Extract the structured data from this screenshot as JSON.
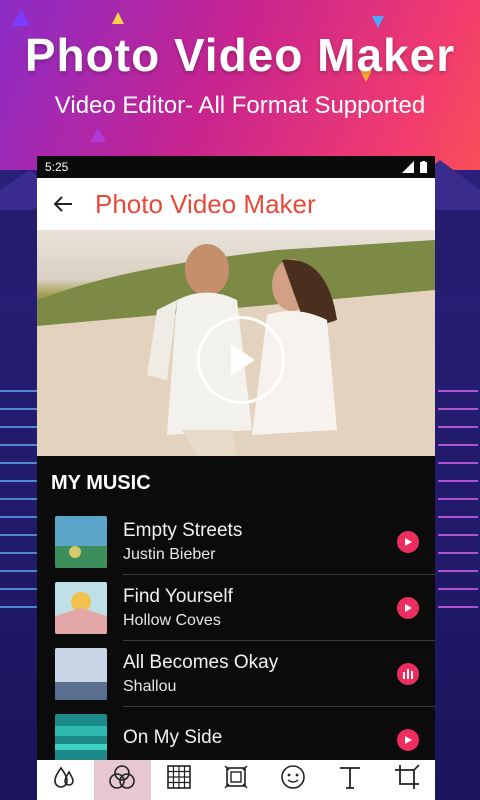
{
  "promo": {
    "title": "Photo Video Maker",
    "subtitle": "Video Editor- All Format Supported"
  },
  "status_bar": {
    "time": "5:25"
  },
  "app_bar": {
    "title": "Photo Video Maker",
    "back_icon": "arrow-left-icon"
  },
  "video": {
    "play_icon": "play-icon"
  },
  "music": {
    "header": "MY MUSIC",
    "tracks": [
      {
        "title": "Empty Streets",
        "artist": "Justin Bieber",
        "state": "play"
      },
      {
        "title": "Find Yourself",
        "artist": "Hollow  Coves",
        "state": "play"
      },
      {
        "title": "All Becomes Okay",
        "artist": "Shallou",
        "state": "playing"
      },
      {
        "title": "On My Side",
        "artist": "",
        "state": "play"
      }
    ]
  },
  "toolbar": {
    "tools": [
      {
        "icon": "drops-icon",
        "label": ""
      },
      {
        "icon": "filter-icon",
        "label": "",
        "active": true
      },
      {
        "icon": "grid-icon",
        "label": ""
      },
      {
        "icon": "frame-icon",
        "label": ""
      },
      {
        "icon": "sticker-icon",
        "label": ""
      },
      {
        "icon": "text-icon",
        "label": ""
      },
      {
        "icon": "crop-icon",
        "label": ""
      }
    ]
  },
  "colors": {
    "accent": "#ec2d5e",
    "title_red": "#e84a3a"
  }
}
